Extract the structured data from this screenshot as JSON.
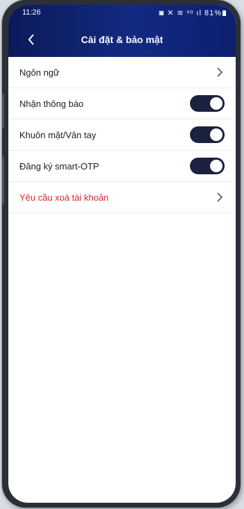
{
  "status_bar": {
    "time": "11:26",
    "icons_text": "◙ ✕ ≋ ᵛᵒ ıl 81%"
  },
  "header": {
    "title": "Cài đặt & bảo mật",
    "back_icon": "chevron-left-icon"
  },
  "settings": [
    {
      "label": "Ngôn ngữ",
      "type": "link"
    },
    {
      "label": "Nhận thông báo",
      "type": "toggle",
      "on": true
    },
    {
      "label": "Khuôn mặt/Vân tay",
      "type": "toggle",
      "on": true
    },
    {
      "label": "Đăng ký smart-OTP",
      "type": "toggle",
      "on": true
    },
    {
      "label": "Yêu cầu xoá tài khoản",
      "type": "link",
      "danger": true
    }
  ],
  "colors": {
    "header": "#122a82",
    "toggle_on": "#1a2240",
    "danger_text": "#d22a2a"
  }
}
